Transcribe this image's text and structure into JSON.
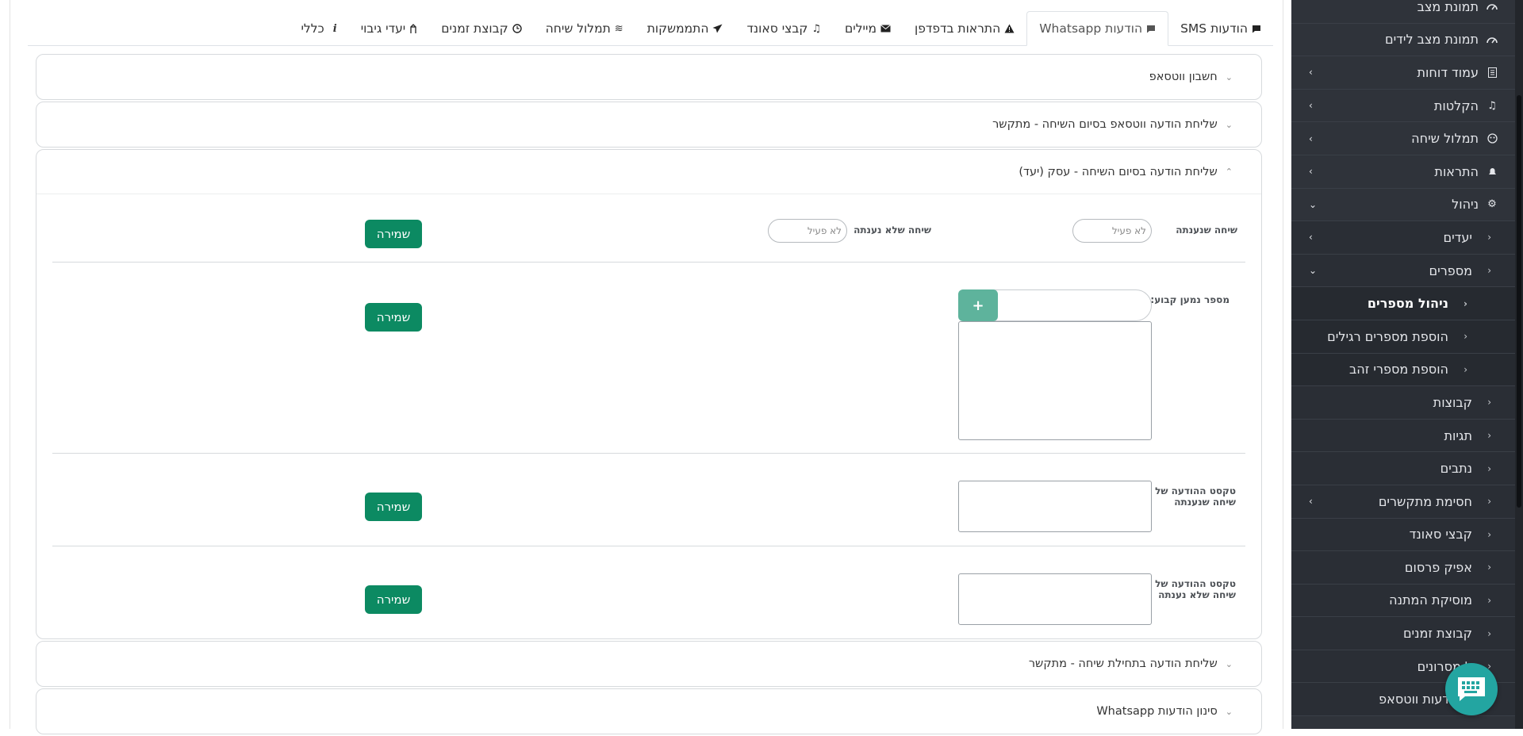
{
  "tabs": [
    {
      "label": "הודעות SMS",
      "icon": "sms-icon",
      "active": false
    },
    {
      "label": "הודעות Whatsapp",
      "icon": "whatsapp-icon",
      "active": true
    },
    {
      "label": "התראות בדפדפן",
      "icon": "warning-icon",
      "active": false
    },
    {
      "label": "מיילים",
      "icon": "envelope-icon",
      "active": false
    },
    {
      "label": "קבצי סאונד",
      "icon": "music-icon",
      "active": false
    },
    {
      "label": "התממשקות",
      "icon": "send-icon",
      "active": false
    },
    {
      "label": "תמלול שיחה",
      "icon": "waves-icon",
      "active": false
    },
    {
      "label": "קבוצת זמנים",
      "icon": "clock-icon",
      "active": false
    },
    {
      "label": "יעדי גיבוי",
      "icon": "backup-icon",
      "active": false
    },
    {
      "label": "כללי",
      "icon": "info-icon",
      "active": false
    }
  ],
  "panels": {
    "whatsapp_account": {
      "title": "חשבון ווטסאפ"
    },
    "end_call_caller": {
      "title": "שליחת הודעה ווטסאפ בסיום השיחה - מתקשר"
    },
    "end_call_business": {
      "title": "שליחת הודעה בסיום השיחה - עסק (יעד)",
      "answered_label": "שיחה שנענתה",
      "answered_toggle": "לא פעיל",
      "unanswered_label": "שיחה שלא נענתה",
      "unanswered_toggle": "לא פעיל",
      "fixed_recipient_label": "מספר נמען קבוע:",
      "add_button": "+",
      "answered_text_label": "טקסט ההודעה של שיחה שנענתה",
      "unanswered_text_label": "טקסט ההודעה של שיחה שלא נענתה",
      "save_label": "שמירה"
    },
    "start_call_caller": {
      "title": "שליחת הודעה בתחילת שיחה - מתקשר"
    },
    "whatsapp_filter": {
      "title": "סינון הודעות Whatsapp"
    }
  },
  "sidebar": {
    "items": [
      {
        "label": "תמונת מצב",
        "icon": "gauge-icon",
        "level": 1,
        "arrow": ""
      },
      {
        "label": "תמונת מצב לידים",
        "icon": "gauge-icon",
        "level": 1,
        "arrow": ""
      },
      {
        "label": "עמוד דוחות",
        "icon": "report-icon",
        "level": 1,
        "arrow": "›"
      },
      {
        "label": "הקלטות",
        "icon": "music-icon",
        "level": 1,
        "arrow": "›"
      },
      {
        "label": "תמלול שיחה",
        "icon": "brain-icon",
        "level": 1,
        "arrow": "›"
      },
      {
        "label": "התראות",
        "icon": "bell-icon",
        "level": 1,
        "arrow": "›"
      },
      {
        "label": "ניהול",
        "icon": "gear-icon",
        "level": 1,
        "arrow": "⌄"
      },
      {
        "label": "יעדים",
        "icon": "",
        "level": 2,
        "arrow": "›"
      },
      {
        "label": "מספרים",
        "icon": "",
        "level": 2,
        "arrow": "⌄"
      },
      {
        "label": "ניהול מספרים",
        "icon": "",
        "level": 3,
        "arrow": "",
        "active": true
      },
      {
        "label": "הוספת מספרים רגילים",
        "icon": "",
        "level": 3,
        "arrow": ""
      },
      {
        "label": "הוספת מספרי זהב",
        "icon": "",
        "level": 3,
        "arrow": ""
      },
      {
        "label": "קבוצות",
        "icon": "",
        "level": 2,
        "arrow": ""
      },
      {
        "label": "תגיות",
        "icon": "",
        "level": 2,
        "arrow": ""
      },
      {
        "label": "נתבים",
        "icon": "",
        "level": 2,
        "arrow": ""
      },
      {
        "label": "חסימת מתקשרים",
        "icon": "",
        "level": 2,
        "arrow": "›"
      },
      {
        "label": "קבצי סאונד",
        "icon": "",
        "level": 2,
        "arrow": ""
      },
      {
        "label": "אפיק פרסום",
        "icon": "",
        "level": 2,
        "arrow": ""
      },
      {
        "label": "מוסיקת המתנה",
        "icon": "",
        "level": 2,
        "arrow": ""
      },
      {
        "label": "קבוצת זמנים",
        "icon": "",
        "level": 2,
        "arrow": ""
      },
      {
        "label": "ל מסרונים",
        "icon": "",
        "level": 2,
        "arrow": ""
      },
      {
        "label": "ל הודעות ווטסאפ",
        "icon": "",
        "level": 2,
        "arrow": ""
      }
    ]
  },
  "colors": {
    "save": "#0c8a62",
    "add": "#5eb39c",
    "sidebar": "#2f333a",
    "chat": "#23a5a1"
  },
  "chat": {
    "icon": "chat-keyboard-icon"
  }
}
